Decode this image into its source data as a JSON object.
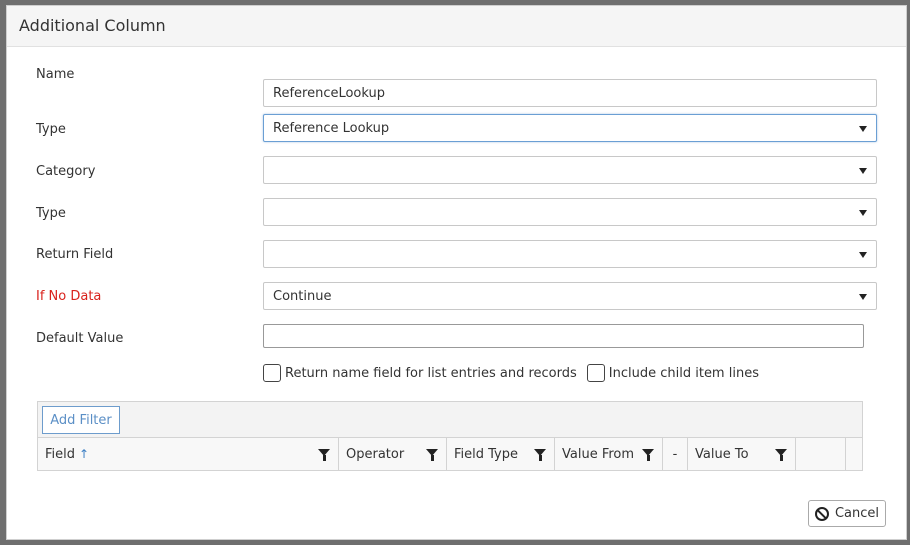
{
  "dialog": {
    "title": "Additional Column"
  },
  "form": {
    "name": {
      "label": "Name",
      "value": "ReferenceLookup"
    },
    "type": {
      "label": "Type",
      "value": "Reference Lookup"
    },
    "category": {
      "label": "Category",
      "value": ""
    },
    "subtype": {
      "label": "Type",
      "value": ""
    },
    "return_field": {
      "label": "Return Field",
      "value": ""
    },
    "if_no_data": {
      "label": "If No Data",
      "value": "Continue",
      "label_color": "#d9221c"
    },
    "default_value": {
      "label": "Default Value",
      "value": ""
    },
    "checkboxes": {
      "return_name": {
        "label": "Return name field for list entries and records",
        "checked": false
      },
      "include_child": {
        "label": "Include child item lines",
        "checked": false
      }
    }
  },
  "grid": {
    "add_filter_label": "Add Filter",
    "columns": [
      {
        "label": "Field",
        "sorted": "asc"
      },
      {
        "label": "Operator"
      },
      {
        "label": "Field Type"
      },
      {
        "label": "Value From"
      },
      {
        "label": "-"
      },
      {
        "label": "Value To"
      }
    ]
  },
  "footer": {
    "cancel_label": "Cancel"
  },
  "colors": {
    "accent": "#5b8fc6",
    "focus": "#6b9fd4",
    "warning_label": "#d9221c"
  }
}
